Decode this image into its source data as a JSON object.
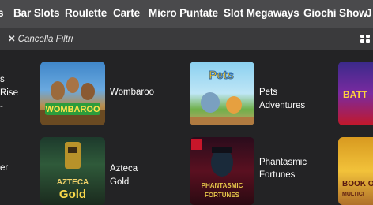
{
  "tabs": [
    "s",
    "Bar Slots",
    "Roulette",
    "Carte",
    "Micro Puntate",
    "Slot Megaways",
    "Giochi Show",
    "J"
  ],
  "filters": {
    "clear_label": "Cancella Filtri",
    "clear_icon": "close-icon",
    "view_icon": "grid-view-icon"
  },
  "games": [
    {
      "name": "s Rise -",
      "thumb_text": ""
    },
    {
      "name": "Wombaroo",
      "thumb_text": "WOMBAROO"
    },
    {
      "name": "Pets Adventures",
      "thumb_text": "Pets"
    },
    {
      "name": "",
      "thumb_text": "BATT"
    },
    {
      "name": "er",
      "thumb_text": ""
    },
    {
      "name": "Azteca Gold",
      "thumb_text": "AZTECA GOLD"
    },
    {
      "name_line1": "Phantasmic",
      "name_line2": "Fortunes",
      "thumb_text": "PHANTASMIC FORTUNES"
    },
    {
      "name": "",
      "thumb_text": "BOOK OF"
    }
  ],
  "colors": {
    "tabbar": "#4a4a4c",
    "filterbar": "#3a3a3c",
    "background": "#232325"
  }
}
